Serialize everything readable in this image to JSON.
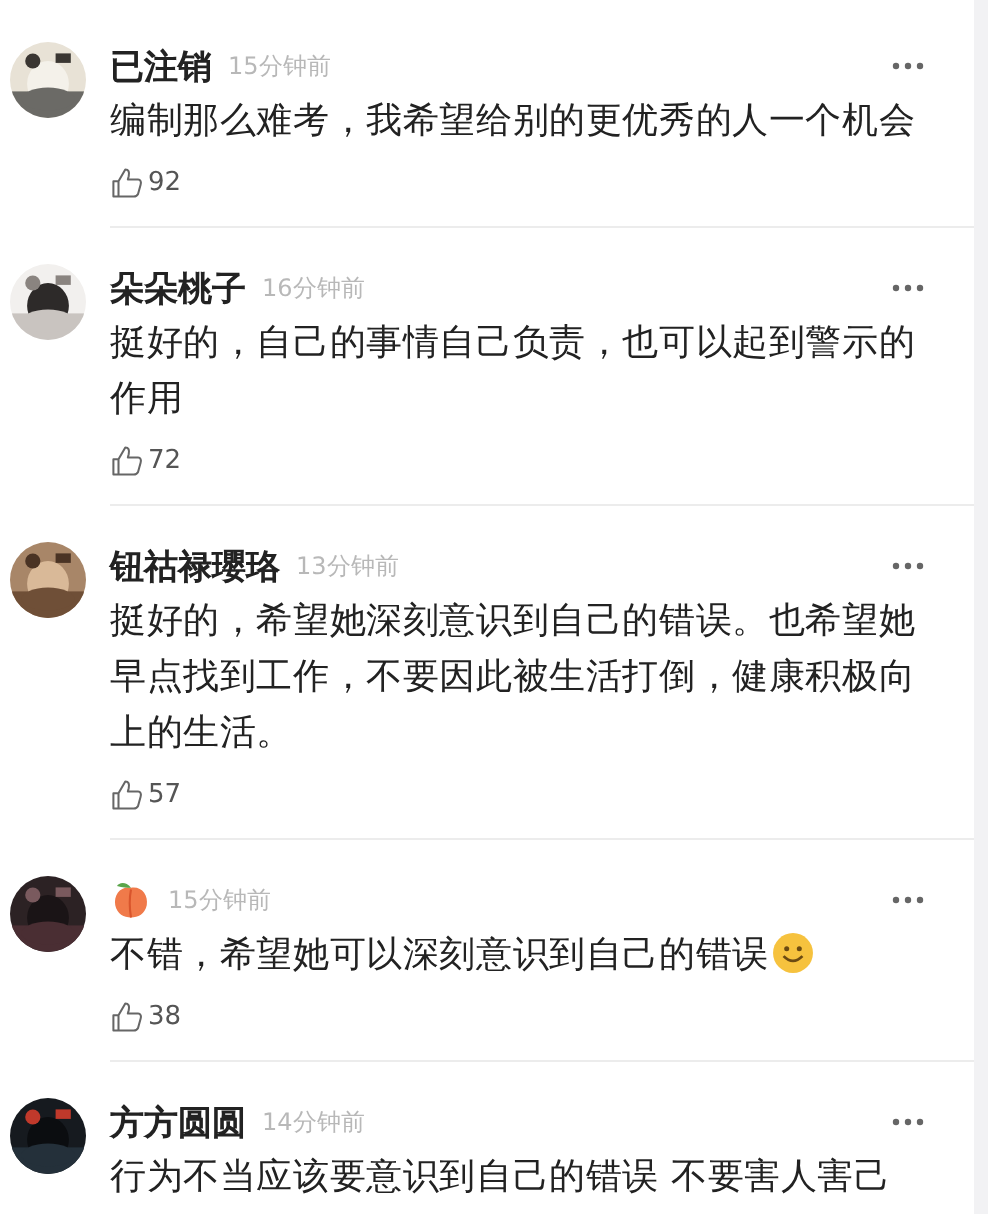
{
  "comments": [
    {
      "kind": "named",
      "name": "已注销",
      "time": "15分钟前",
      "parts": [
        {
          "kind": "text",
          "text": "编制那么难考，我希望给别的更优秀的人一个机会"
        }
      ],
      "likes": "92"
    },
    {
      "kind": "named",
      "name": "朵朵桃子",
      "time": "16分钟前",
      "parts": [
        {
          "kind": "text",
          "text": "挺好的，自己的事情自己负责，也可以起到警示的作用"
        }
      ],
      "likes": "72"
    },
    {
      "kind": "named",
      "name": "钮祜禄瓔珞",
      "time": "13分钟前",
      "parts": [
        {
          "kind": "text",
          "text": "挺好的，希望她深刻意识到自己的错误。也希望她早点找到工作，不要因此被生活打倒，健康积极向上的生活。"
        }
      ],
      "likes": "57"
    },
    {
      "kind": "peach",
      "time": "15分钟前",
      "parts": [
        {
          "kind": "text",
          "text": "不错，希望她可以深刻意识到自己的错误"
        },
        {
          "kind": "smiley"
        }
      ],
      "likes": "38"
    },
    {
      "kind": "named",
      "name": "方方圆圆",
      "time": "14分钟前",
      "parts": [
        {
          "kind": "text",
          "text": "行为不当应该要意识到自己的错误 不要害人害己"
        }
      ]
    }
  ]
}
